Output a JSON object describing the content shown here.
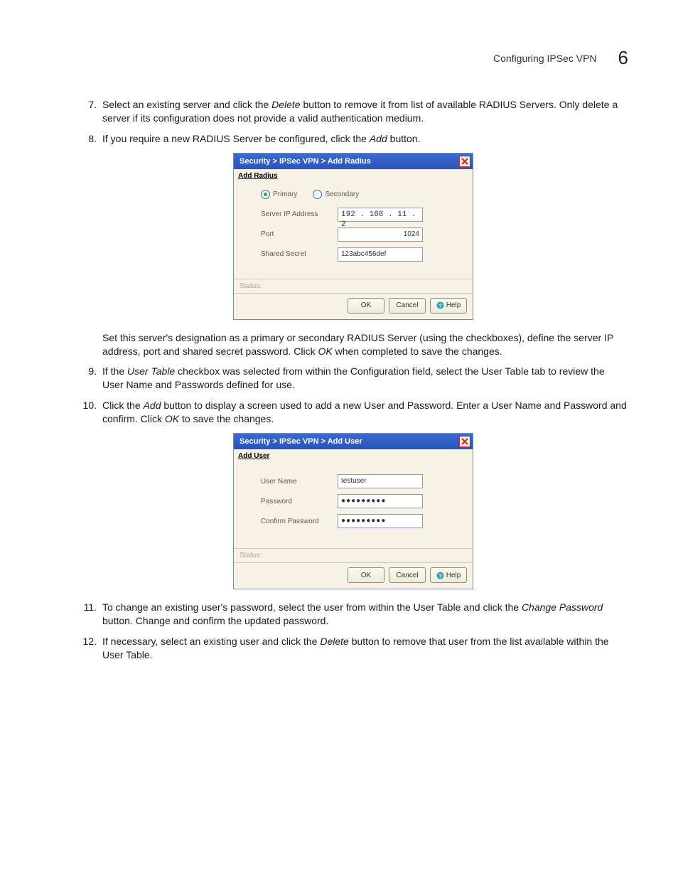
{
  "header": {
    "title": "Configuring IPSec VPN",
    "chapter": "6"
  },
  "steps": {
    "s7": {
      "num": "7.",
      "p1": "Select an existing server and click the ",
      "it1": "Delete",
      "p2": " button to remove it from list of available RADIUS Servers. Only delete a server if its configuration does not provide a valid authentication medium."
    },
    "s8": {
      "num": "8.",
      "p1": "If you require a new RADIUS Server be configured, click the ",
      "it1": "Add",
      "p2": " button."
    },
    "s8b": {
      "p1": "Set this server's designation as a primary or secondary RADIUS Server (using the checkboxes), define the server IP address, port and shared secret password. Click ",
      "it1": "OK",
      "p2": " when completed to save the changes."
    },
    "s9": {
      "num": "9.",
      "p1": "If the ",
      "it1": "User Table",
      "p2": " checkbox was selected from within the Configuration field, select the User Table tab to review the User Name and Passwords defined for use."
    },
    "s10": {
      "num": "10.",
      "p1": "Click the ",
      "it1": "Add",
      "p2": " button to display a screen used to add a new User and Password. Enter a User Name and Password and confirm. Click ",
      "it2": "OK",
      "p3": " to save the changes."
    },
    "s11": {
      "num": "11.",
      "p1": "To change an existing user's password, select the user from within the User Table and click the ",
      "it1": "Change Password",
      "p2": " button. Change and confirm the updated password."
    },
    "s12": {
      "num": "12.",
      "p1": "If necessary, select an existing user and click the ",
      "it1": "Delete",
      "p2": " button to remove that user from the list available within the User Table."
    }
  },
  "dialog1": {
    "title": "Security > IPSec VPN > Add Radius",
    "section": "Add Radius",
    "radio_primary": "Primary",
    "radio_secondary": "Secondary",
    "labels": {
      "ip": "Server IP Address",
      "port": "Port",
      "secret": "Shared Secret"
    },
    "values": {
      "ip": "192 . 168 .  11  .   2",
      "port": "1024",
      "secret": "123abc456def"
    },
    "status": "Status:",
    "buttons": {
      "ok": "OK",
      "cancel": "Cancel",
      "help": "Help"
    }
  },
  "dialog2": {
    "title": "Security > IPSec VPN > Add User",
    "section": "Add User",
    "labels": {
      "user": "User Name",
      "pass": "Password",
      "confirm": "Confirm Password"
    },
    "values": {
      "user": "testuser",
      "pass": "●●●●●●●●●",
      "confirm": "●●●●●●●●●"
    },
    "status": "Status:",
    "buttons": {
      "ok": "OK",
      "cancel": "Cancel",
      "help": "Help"
    }
  }
}
